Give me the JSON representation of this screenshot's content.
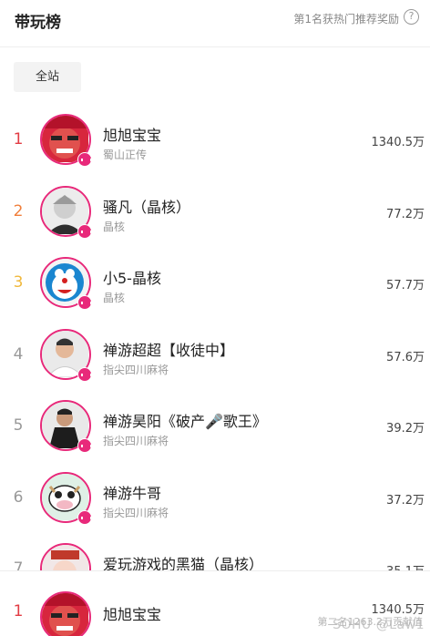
{
  "header": {
    "title": "带玩榜",
    "reward_text": "第1名获热门推荐奖励",
    "help_symbol": "?"
  },
  "filter": {
    "label": "全站"
  },
  "accent_color": "#e8297a",
  "rank_colors": [
    "#e23c44",
    "#f07f3c",
    "#f0b83c",
    "#999999"
  ],
  "list": [
    {
      "rank": "1",
      "name": "旭旭宝宝",
      "game": "蜀山正传",
      "value": "1340.5万",
      "avatar": "red-face"
    },
    {
      "rank": "2",
      "name": "骚凡（晶核）",
      "game": "晶核",
      "value": "77.2万",
      "avatar": "gray-anime"
    },
    {
      "rank": "3",
      "name": "小5-晶核",
      "game": "晶核",
      "value": "57.7万",
      "avatar": "blue-cat"
    },
    {
      "rank": "4",
      "name": "禅游超超【收徒中】",
      "game": "指尖四川麻将",
      "value": "57.6万",
      "avatar": "man-white"
    },
    {
      "rank": "5",
      "name": "禅游昊阳《破产🎤歌王》",
      "game": "指尖四川麻将",
      "value": "39.2万",
      "avatar": "man-dark"
    },
    {
      "rank": "6",
      "name": "禅游牛哥",
      "game": "指尖四川麻将",
      "value": "37.2万",
      "avatar": "cow"
    },
    {
      "rank": "7",
      "name": "爱玩游戏的黑猫（晶核）",
      "game": "",
      "value": "35.1万",
      "avatar": "cartoon"
    }
  ],
  "footer": {
    "rank": "1",
    "name": "旭旭宝宝",
    "value": "1340.5万",
    "watermark": "SOHU @Law1",
    "sub": "第二名1263.2万贡献值"
  }
}
